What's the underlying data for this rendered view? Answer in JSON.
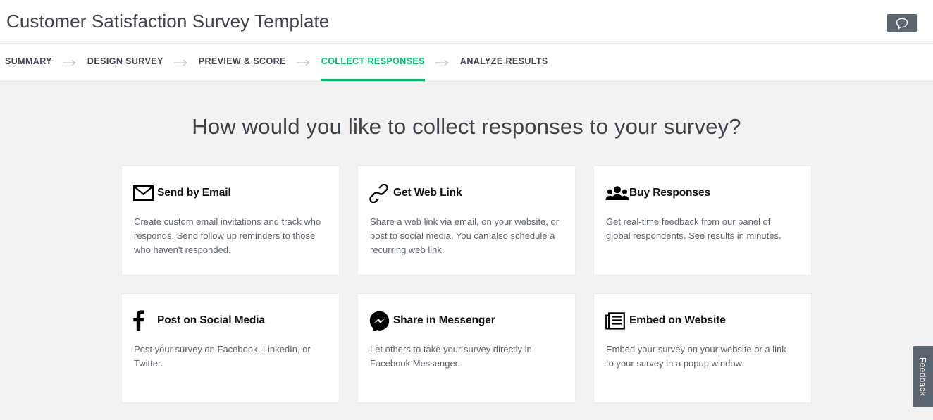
{
  "header": {
    "title": "Customer Satisfaction Survey Template",
    "chat_button": {
      "icon": "speech-bubble-icon",
      "background": "#5b6770"
    }
  },
  "nav": {
    "active_color": "#00bf6f",
    "arrow_icon": "arrow-right-icon",
    "steps": [
      {
        "label": "SUMMARY",
        "active": false
      },
      {
        "label": "DESIGN SURVEY",
        "active": false
      },
      {
        "label": "PREVIEW & SCORE",
        "active": false
      },
      {
        "label": "COLLECT RESPONSES",
        "active": true
      },
      {
        "label": "ANALYZE RESULTS",
        "active": false
      }
    ]
  },
  "main": {
    "heading": "How would you like to collect responses to your survey?",
    "cards": [
      {
        "icon": "envelope-icon",
        "title": "Send by Email",
        "description": "Create custom email invitations and track who responds. Send follow up reminders to those who haven't responded."
      },
      {
        "icon": "link-chain-icon",
        "title": "Get Web Link",
        "description": "Share a web link via email, on your website, or post to social media. You can also schedule a recurring web link."
      },
      {
        "icon": "people-group-icon",
        "title": "Buy Responses",
        "description": "Get real-time feedback from our panel of global respondents. See results in minutes."
      },
      {
        "icon": "facebook-f-icon",
        "title": "Post on Social Media",
        "description": "Post your survey on Facebook, LinkedIn, or Twitter."
      },
      {
        "icon": "messenger-icon",
        "title": "Share in Messenger",
        "description": "Let others to take your survey directly in Facebook Messenger."
      },
      {
        "icon": "embed-window-icon",
        "title": "Embed on Website",
        "description": "Embed your survey on your website or a link to your survey in a popup window."
      }
    ]
  },
  "feedback": {
    "label": "Feedback",
    "background": "#5b6770"
  }
}
